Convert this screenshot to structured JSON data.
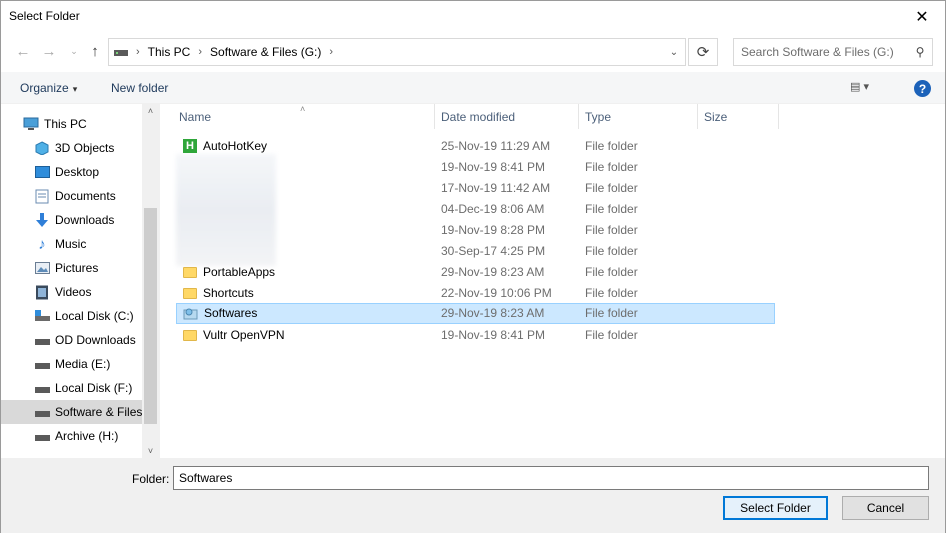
{
  "window": {
    "title": "Select Folder",
    "close_glyph": "✕"
  },
  "nav": {
    "back_icon": "back-arrow-icon",
    "forward_icon": "forward-arrow-icon",
    "recent_icon": "chevron-down-icon",
    "up_icon": "up-arrow-icon"
  },
  "address": {
    "crumbs": [
      "This PC",
      "Software & Files (G:)"
    ],
    "separator": "›",
    "dropdown_glyph": "⌄",
    "refresh_glyph": "⟳"
  },
  "search": {
    "placeholder": "Search Software & Files (G:)",
    "icon_glyph": "⚲"
  },
  "toolbar": {
    "organize_label": "Organize",
    "organize_caret": "▾",
    "new_folder_label": "New folder",
    "view_glyph": "▤ ▾",
    "help_glyph": "?"
  },
  "sidebar": {
    "items": [
      {
        "label": "This PC",
        "icon": "pc-icon"
      },
      {
        "label": "3D Objects",
        "icon": "cube-icon"
      },
      {
        "label": "Desktop",
        "icon": "desktop-icon"
      },
      {
        "label": "Documents",
        "icon": "documents-icon"
      },
      {
        "label": "Downloads",
        "icon": "download-icon"
      },
      {
        "label": "Music",
        "icon": "music-icon"
      },
      {
        "label": "Pictures",
        "icon": "pictures-icon"
      },
      {
        "label": "Videos",
        "icon": "videos-icon"
      },
      {
        "label": "Local Disk (C:)",
        "icon": "drive-icon"
      },
      {
        "label": "OD Downloads",
        "icon": "drive-icon"
      },
      {
        "label": "Media (E:)",
        "icon": "drive-icon"
      },
      {
        "label": "Local Disk (F:)",
        "icon": "drive-icon"
      },
      {
        "label": "Software & Files",
        "icon": "drive-icon",
        "selected": true
      },
      {
        "label": "Archive (H:)",
        "icon": "drive-icon"
      }
    ],
    "scroll_up_glyph": "˄",
    "scroll_down_glyph": "˅"
  },
  "columns": {
    "name": "Name",
    "date": "Date modified",
    "type": "Type",
    "size": "Size",
    "sort_glyph": "˄"
  },
  "files": [
    {
      "name": "AutoHotKey",
      "date": "25-Nov-19 11:29 AM",
      "type": "File folder",
      "icon": "autohotkey-icon"
    },
    {
      "name": "",
      "date": "19-Nov-19 8:41 PM",
      "type": "File folder",
      "icon": "blurred"
    },
    {
      "name": "",
      "date": "17-Nov-19 11:42 AM",
      "type": "File folder",
      "icon": "blurred"
    },
    {
      "name": "",
      "date": "04-Dec-19 8:06 AM",
      "type": "File folder",
      "icon": "blurred"
    },
    {
      "name": "",
      "date": "19-Nov-19 8:28 PM",
      "type": "File folder",
      "icon": "blurred"
    },
    {
      "name": "",
      "date": "30-Sep-17 4:25 PM",
      "type": "File folder",
      "icon": "blurred"
    },
    {
      "name": "PortableApps",
      "date": "29-Nov-19 8:23 AM",
      "type": "File folder",
      "icon": "folder-icon"
    },
    {
      "name": "Shortcuts",
      "date": "22-Nov-19 10:06 PM",
      "type": "File folder",
      "icon": "folder-icon"
    },
    {
      "name": "Softwares",
      "date": "29-Nov-19 8:23 AM",
      "type": "File folder",
      "icon": "special-folder-icon",
      "selected": true
    },
    {
      "name": "Vultr OpenVPN",
      "date": "19-Nov-19 8:41 PM",
      "type": "File folder",
      "icon": "folder-icon"
    }
  ],
  "bottom": {
    "folder_label": "Folder:",
    "folder_value": "Softwares",
    "select_button": "Select Folder",
    "cancel_button": "Cancel"
  },
  "colors": {
    "accent": "#0078d7",
    "selection": "#cce8ff",
    "link": "#1e395b",
    "help": "#1c62b9"
  }
}
